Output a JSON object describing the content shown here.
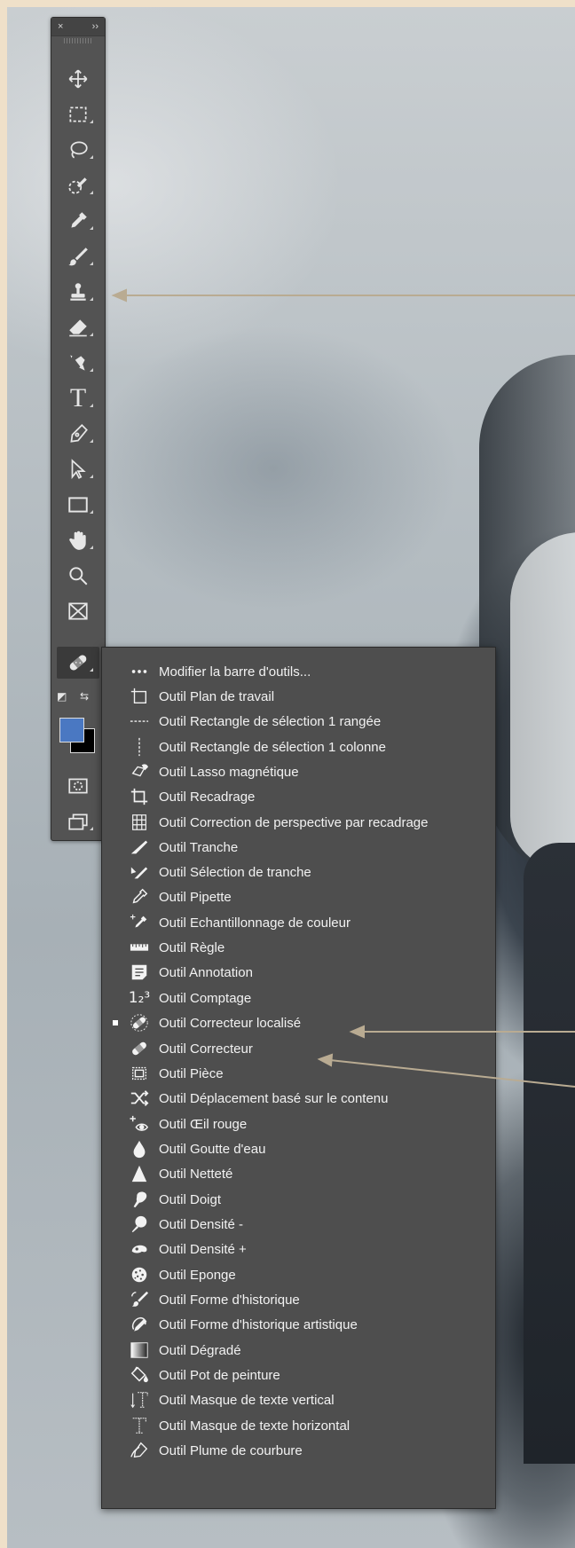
{
  "toolbar": {
    "close_glyph": "×",
    "expand_glyph": "››",
    "tools": [
      {
        "name": "move-tool",
        "icon": "move-icon"
      },
      {
        "name": "marquee-tool",
        "icon": "marquee-icon"
      },
      {
        "name": "lasso-tool",
        "icon": "lasso-icon"
      },
      {
        "name": "quick-selection-tool",
        "icon": "quick-selection-icon"
      },
      {
        "name": "eyedropper-tool",
        "icon": "eyedropper-icon"
      },
      {
        "name": "brush-tool",
        "icon": "brush-icon"
      },
      {
        "name": "clone-stamp-tool",
        "icon": "stamp-icon"
      },
      {
        "name": "eraser-tool",
        "icon": "eraser-icon"
      },
      {
        "name": "history-brush-tool",
        "icon": "history-brush-icon"
      },
      {
        "name": "type-tool",
        "icon": "type-icon",
        "glyph": "T"
      },
      {
        "name": "pen-tool",
        "icon": "pen-icon"
      },
      {
        "name": "path-selection-tool",
        "icon": "arrow-icon"
      },
      {
        "name": "rectangle-tool",
        "icon": "rectangle-icon"
      },
      {
        "name": "hand-tool",
        "icon": "hand-icon"
      },
      {
        "name": "zoom-tool",
        "icon": "zoom-icon"
      },
      {
        "name": "frame-tool",
        "icon": "frame-icon"
      },
      {
        "name": "healing-tool",
        "icon": "bandage-icon"
      }
    ],
    "foreground_color": "#4a78c2",
    "background_color": "#000000"
  },
  "menu": {
    "items": [
      {
        "label": "Modifier la barre d'outils...",
        "icon": "ellipsis-icon"
      },
      {
        "label": "Outil Plan de travail",
        "icon": "artboard-icon"
      },
      {
        "label": "Outil Rectangle de sélection 1 rangée",
        "icon": "row-marquee-icon"
      },
      {
        "label": "Outil Rectangle de sélection 1 colonne",
        "icon": "column-marquee-icon"
      },
      {
        "label": "Outil Lasso magnétique",
        "icon": "magnetic-lasso-icon"
      },
      {
        "label": "Outil Recadrage",
        "icon": "crop-icon"
      },
      {
        "label": "Outil Correction de perspective par recadrage",
        "icon": "perspective-crop-icon"
      },
      {
        "label": "Outil Tranche",
        "icon": "slice-icon"
      },
      {
        "label": "Outil Sélection de tranche",
        "icon": "slice-select-icon"
      },
      {
        "label": "Outil Pipette",
        "icon": "eyedropper-icon"
      },
      {
        "label": "Outil Echantillonnage de couleur",
        "icon": "color-sampler-icon"
      },
      {
        "label": "Outil Règle",
        "icon": "ruler-icon"
      },
      {
        "label": "Outil Annotation",
        "icon": "note-icon"
      },
      {
        "label": "Outil Comptage",
        "icon": "count-icon",
        "glyph": "1₂³"
      },
      {
        "label": "Outil Correcteur localisé",
        "icon": "spot-healing-icon",
        "selected": true
      },
      {
        "label": "Outil Correcteur",
        "icon": "healing-icon"
      },
      {
        "label": "Outil Pièce",
        "icon": "patch-icon"
      },
      {
        "label": "Outil Déplacement basé sur le contenu",
        "icon": "content-move-icon"
      },
      {
        "label": "Outil Œil rouge",
        "icon": "red-eye-icon"
      },
      {
        "label": "Outil Goutte d'eau",
        "icon": "blur-icon"
      },
      {
        "label": "Outil Netteté",
        "icon": "sharpen-icon"
      },
      {
        "label": "Outil Doigt",
        "icon": "smudge-icon"
      },
      {
        "label": "Outil Densité -",
        "icon": "dodge-icon"
      },
      {
        "label": "Outil Densité +",
        "icon": "burn-icon"
      },
      {
        "label": "Outil Eponge",
        "icon": "sponge-icon"
      },
      {
        "label": "Outil Forme d'historique",
        "icon": "history-brush-icon"
      },
      {
        "label": "Outil Forme d'historique artistique",
        "icon": "art-history-brush-icon"
      },
      {
        "label": "Outil Dégradé",
        "icon": "gradient-icon"
      },
      {
        "label": "Outil Pot de peinture",
        "icon": "paint-bucket-icon"
      },
      {
        "label": "Outil Masque de texte vertical",
        "icon": "vertical-type-mask-icon"
      },
      {
        "label": "Outil Masque de texte horizontal",
        "icon": "horizontal-type-mask-icon"
      },
      {
        "label": "Outil Plume de courbure",
        "icon": "curvature-pen-icon"
      }
    ]
  },
  "colors": {
    "annotation_arrow": "#b9ab92",
    "panel": "#535353",
    "menu": "#4e4e4e"
  }
}
